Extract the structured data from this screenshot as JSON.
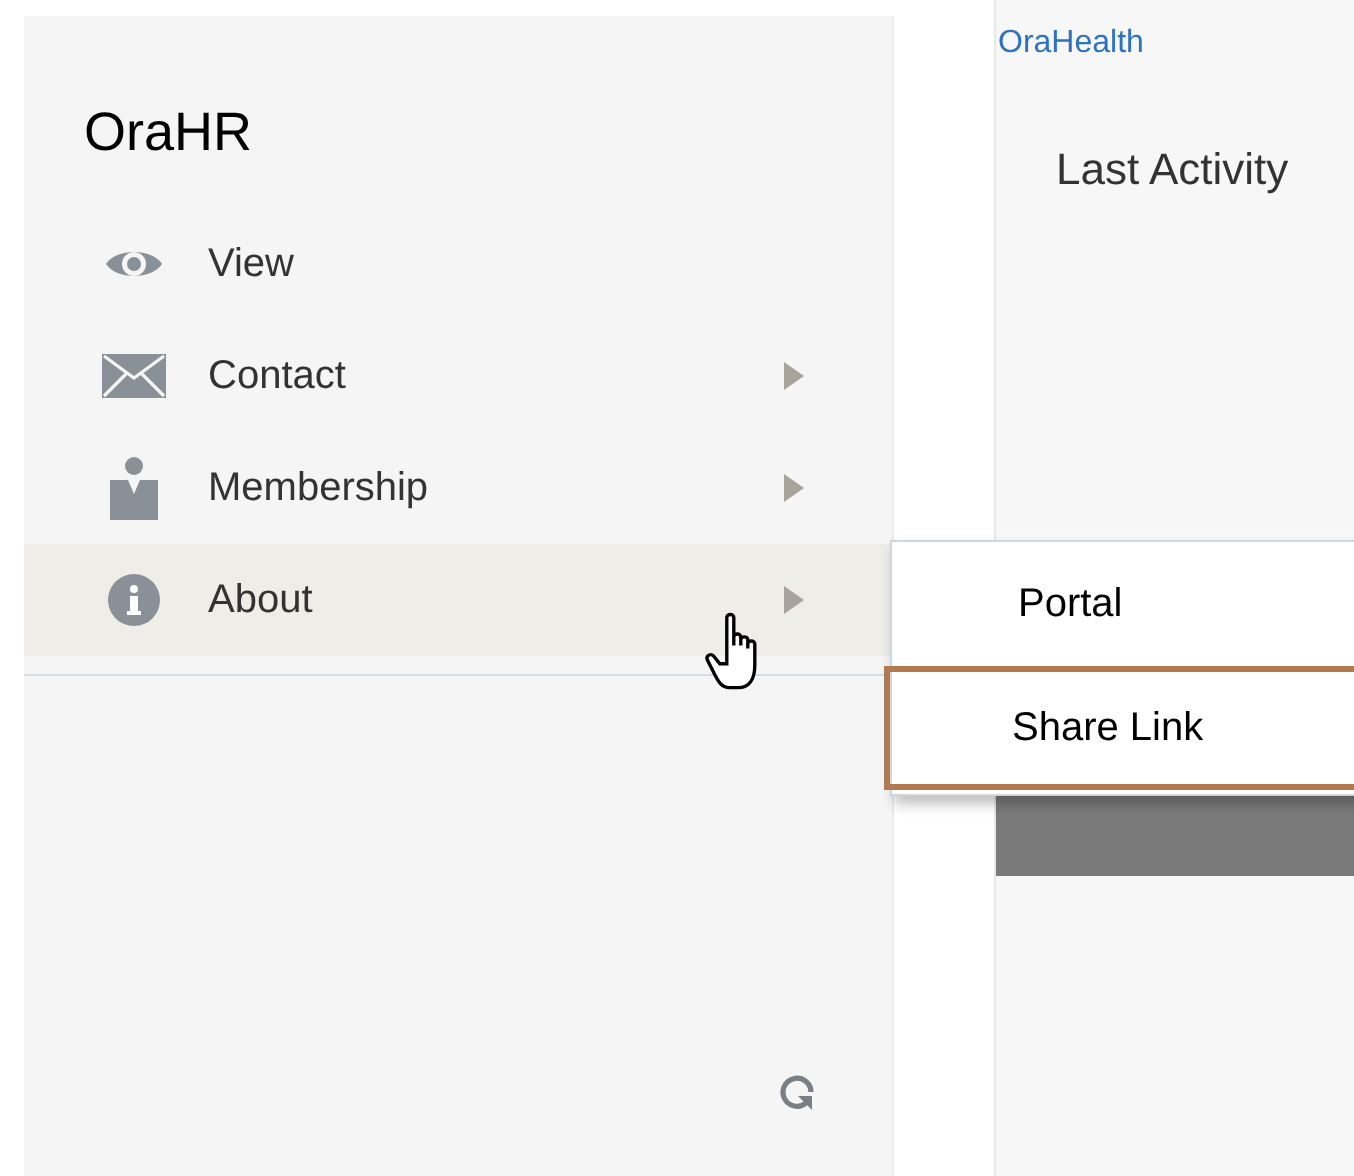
{
  "sidebar": {
    "title": "OraHR",
    "items": [
      {
        "kind": "eye",
        "label": "View",
        "has_submenu": false,
        "selected": false
      },
      {
        "kind": "envelope",
        "label": "Contact",
        "has_submenu": true,
        "selected": false
      },
      {
        "kind": "person",
        "label": "Membership",
        "has_submenu": true,
        "selected": false
      },
      {
        "kind": "info",
        "label": "About",
        "has_submenu": true,
        "selected": true
      }
    ]
  },
  "content": {
    "link": "OraHealth",
    "heading": "Last Activity"
  },
  "submenu": {
    "items": [
      {
        "label": "Portal",
        "focused": false
      },
      {
        "label": "Share Link",
        "focused": true
      }
    ]
  }
}
